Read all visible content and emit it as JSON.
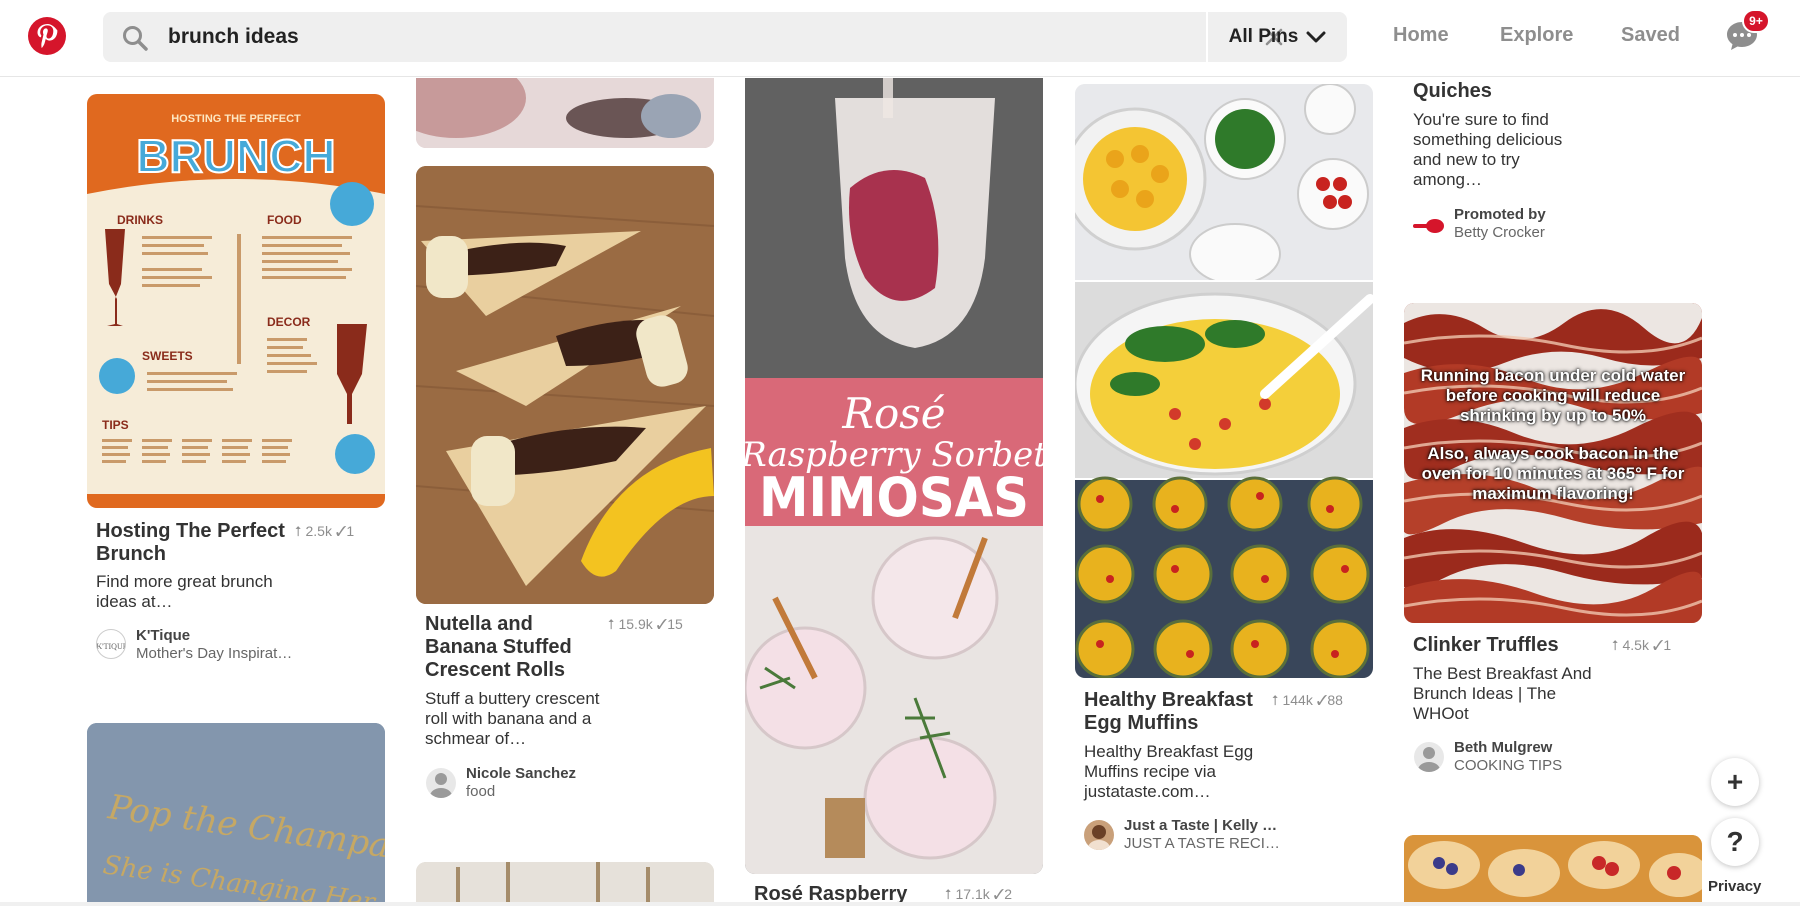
{
  "header": {
    "search": {
      "value": "brunch ideas",
      "placeholder": "Search"
    },
    "scope_label": "All Pins",
    "nav": [
      "Home",
      "Explore",
      "Saved"
    ],
    "notification_badge": "9+"
  },
  "pins": {
    "brunch": {
      "title": "Hosting The Perfect Brunch",
      "saves": "2.5k",
      "tried": "1",
      "description": "Find more great brunch ideas at…",
      "attr_name": "K'Tique",
      "attr_board": "Mother's Day Inspirat…",
      "poster_heading": "BRUNCH",
      "poster_subheading": "HOSTING THE PERFECT",
      "poster_sections": [
        "DRINKS",
        "FOOD",
        "DECOR",
        "SWEETS",
        "TIPS"
      ]
    },
    "nutella": {
      "title": "Nutella and Banana Stuffed Crescent Rolls",
      "saves": "15.9k",
      "tried": "15",
      "description": "Stuff a buttery crescent roll with banana and a schmear of…",
      "attr_name": "Nicole Sanchez",
      "attr_board": "food"
    },
    "mimosa": {
      "overlay_line1": "Rosé",
      "overlay_line2": "Raspberry Sorbet",
      "overlay_line3": "MIMOSAS",
      "title": "Rosé Raspberry",
      "saves": "17.1k",
      "tried": "2"
    },
    "muffins": {
      "title": "Healthy Breakfast Egg Muffins",
      "saves": "144k",
      "tried": "88",
      "description": "Healthy Breakfast Egg Muffins recipe via justataste.com…",
      "attr_name": "Just a Taste | Kelly …",
      "attr_board": "JUST A TASTE RECI…"
    },
    "quiches": {
      "title": "Quiches",
      "description": "You're sure to find something delicious and new to try among…",
      "promoted_label": "Promoted by",
      "promoted_by": "Betty Crocker"
    },
    "bacon": {
      "overlay_1": "Running bacon under cold water before cooking will reduce shrinking by up to 50%",
      "overlay_2": "Also, always cook bacon in the oven for 10 minutes at 365° F for maximum flavoring!",
      "title": "Clinker Truffles",
      "saves": "4.5k",
      "tried": "1",
      "description": "The Best Breakfast And Brunch Ideas | The WHOot",
      "attr_name": "Beth Mulgrew",
      "attr_board": "COOKING TIPS"
    },
    "champagne": {
      "line1": "Pop the Champagne",
      "line2": "She is Changing Her Name"
    }
  },
  "floating": {
    "add": "+",
    "help": "?",
    "privacy": "Privacy"
  },
  "colors": {
    "brand": "#d5152b",
    "text_muted": "#8e8e8e"
  }
}
